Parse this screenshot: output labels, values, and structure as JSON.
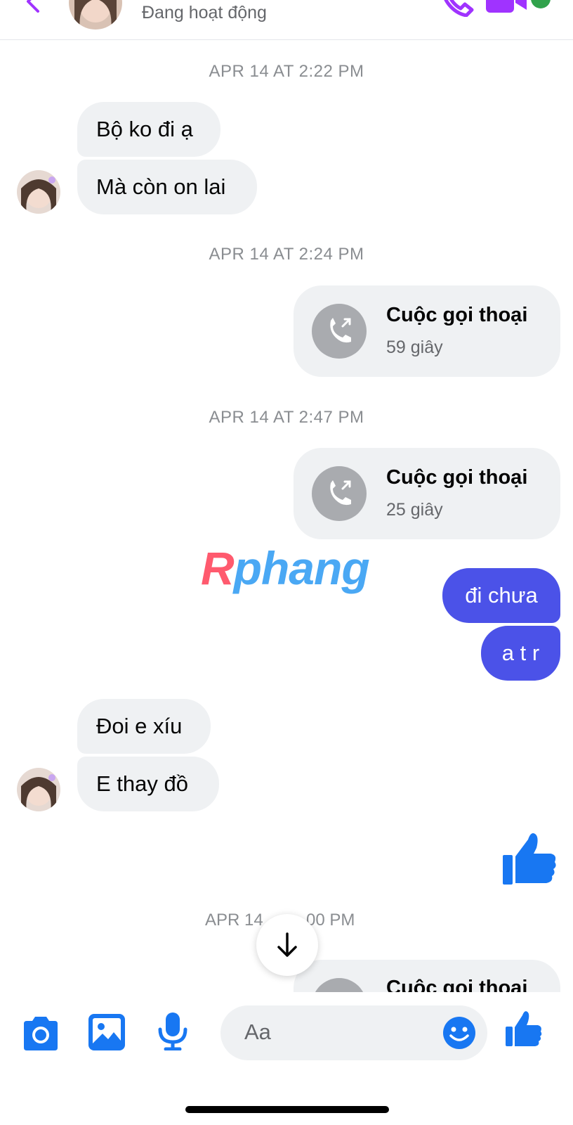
{
  "header": {
    "status": "Đang hoạt động",
    "accent_color": "#a033ff",
    "icons": [
      "back-chevron-icon",
      "phone-icon",
      "video-camera-icon"
    ]
  },
  "messages": {
    "ts1": "APR 14 AT 2:22 PM",
    "m1": "Bộ ko đi ạ",
    "m2": "Mà còn on lai",
    "ts2": "APR 14 AT 2:24 PM",
    "call1": {
      "title": "Cuộc gọi thoại",
      "duration": "59 giây"
    },
    "ts3": "APR 14 AT 2:47 PM",
    "call2": {
      "title": "Cuộc gọi thoại",
      "duration": "25 giây"
    },
    "m3": "đi chưa",
    "m4": "a t r",
    "m5": "Đoi e xíu",
    "m6": "E thay đồ",
    "ts4": "APR 14",
    "ts4_tail": "00 PM",
    "call3": {
      "title": "Cuộc gọi thoại"
    }
  },
  "watermark": {
    "first": "R",
    "rest": "phang"
  },
  "composer": {
    "placeholder": "Aa"
  },
  "colors": {
    "incoming_bubble": "#eff1f3",
    "outgoing_bubble": "#4b52e8",
    "icon_blue": "#1877f2"
  }
}
